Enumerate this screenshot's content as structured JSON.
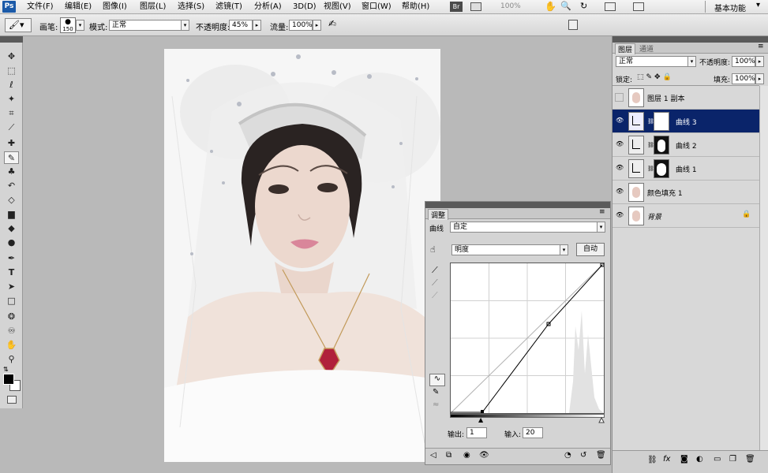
{
  "menubar": {
    "logo": "Ps",
    "items": [
      "文件(F)",
      "编辑(E)",
      "图像(I)",
      "图层(L)",
      "选择(S)",
      "滤镜(T)",
      "分析(A)",
      "3D(D)",
      "视图(V)",
      "窗口(W)",
      "帮助(H)"
    ],
    "br_badge": "Br",
    "zoom": "100%",
    "workspace": "基本功能"
  },
  "options": {
    "brush_label": "画笔:",
    "brush_size": "150",
    "mode_label": "模式:",
    "mode_value": "正常",
    "opacity_label": "不透明度:",
    "opacity_value": "45%",
    "flow_label": "流量:",
    "flow_value": "100%"
  },
  "layers_panel": {
    "tabs": [
      "图层",
      "通道"
    ],
    "blend_mode": "正常",
    "opacity_label": "不透明度:",
    "opacity_value": "100%",
    "lock_label": "锁定:",
    "fill_label": "填充:",
    "fill_value": "100%",
    "layers": [
      {
        "name": "图层 1 副本",
        "visible": false,
        "selected": false
      },
      {
        "name": "曲线 3",
        "visible": true,
        "selected": true
      },
      {
        "name": "曲线 2",
        "visible": true,
        "selected": false
      },
      {
        "name": "曲线 1",
        "visible": true,
        "selected": false
      },
      {
        "name": "颜色填充 1",
        "visible": true,
        "selected": false
      },
      {
        "name": "背景",
        "visible": true,
        "selected": false
      }
    ]
  },
  "adjustments": {
    "tab": "调整",
    "curves_label": "曲线",
    "preset_value": "自定",
    "channel_value": "明度",
    "auto_button": "自动",
    "output_label": "输出:",
    "output_value": "1",
    "input_label": "输入:",
    "input_value": "20"
  }
}
